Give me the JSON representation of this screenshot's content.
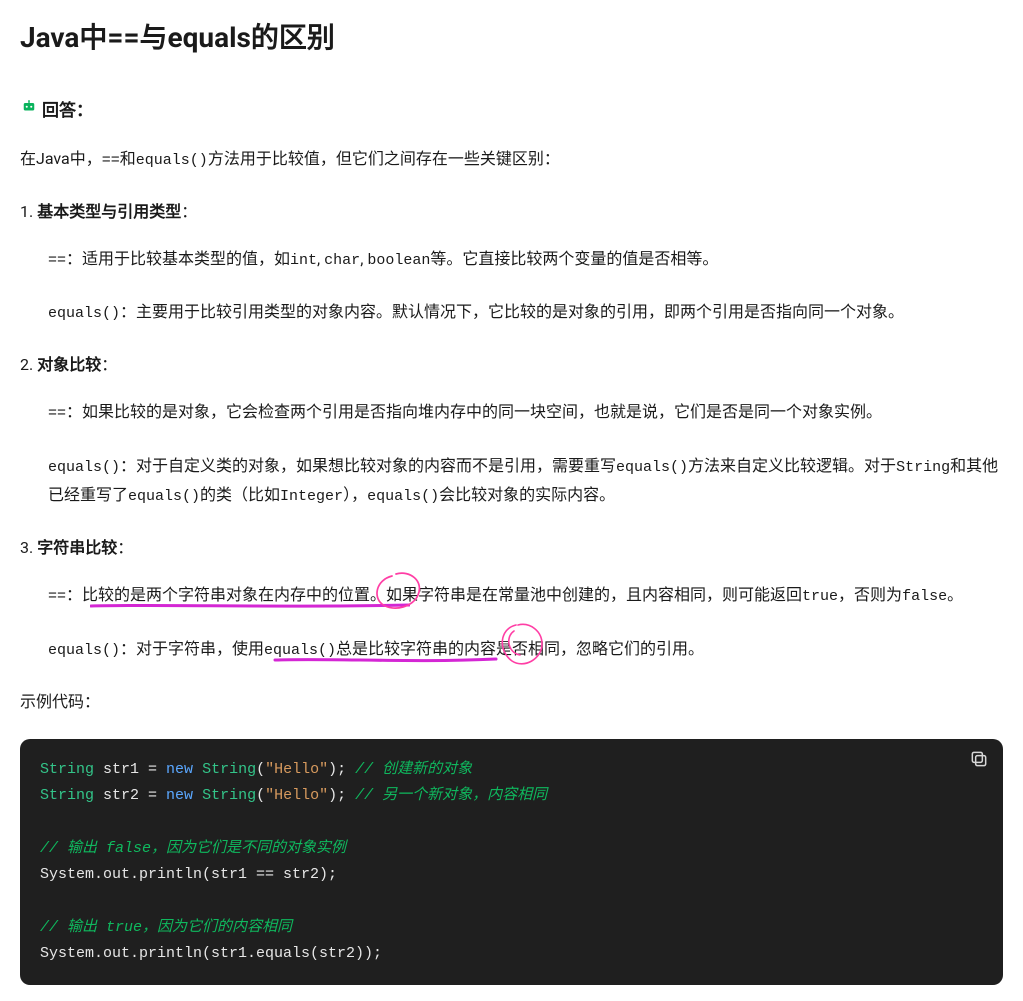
{
  "title": "Java中==与equals的区别",
  "answer_label": "回答：",
  "intro_pre": "在Java中，",
  "intro_code1": "==",
  "intro_mid1": "和",
  "intro_code2": "equals()",
  "intro_post": "方法用于比较值，但它们之间存在一些关键区别：",
  "sections": [
    {
      "num": "1. ",
      "head": "基本类型与引用类型",
      "colon": "：",
      "items": [
        {
          "code": "==",
          "sep": "：适用于比较基本类型的值，如",
          "c2": "int",
          "s2": ", ",
          "c3": "char",
          "s3": ", ",
          "c4": "boolean",
          "s4": "等。它直接比较两个变量的值是否相等。"
        },
        {
          "code": "equals()",
          "sep": "：主要用于比较引用类型的对象内容。默认情况下，它比较的是对象的引用，即两个引用是否指向同一个对象。"
        }
      ]
    },
    {
      "num": "2. ",
      "head": "对象比较",
      "colon": "：",
      "items": [
        {
          "code": "==",
          "sep": "：如果比较的是对象，它会检查两个引用是否指向堆内存中的同一块空间，也就是说，它们是否是同一个对象实例。"
        },
        {
          "code": "equals()",
          "sep": "：对于自定义类的对象，如果想比较对象的内容而不是引用，需要重写",
          "c2": "equals()",
          "s2": "方法来自定义比较逻辑。对于",
          "c3": "String",
          "s3": "和其他已经重写了",
          "c4": "equals()",
          "s4": "的类（比如",
          "c5": "Integer",
          "s5": "），",
          "c6": "equals()",
          "s6": "会比较对象的实际内容。"
        }
      ]
    },
    {
      "num": "3. ",
      "head": "字符串比较",
      "colon": "：",
      "items": [
        {
          "code": "==",
          "sep": "：比较的是两个字符串对象在内存中的位置。如果字符串是在常量池中创建的，且内容相同，则可能返回",
          "c2": "true",
          "s2": "，否则为",
          "c3": "false",
          "s3": "。"
        },
        {
          "code": "equals()",
          "sep": "：对于字符串，使用",
          "c2": "equals()",
          "s2": "总是比较字符串的内容是否相同，忽略它们的引用。"
        }
      ]
    }
  ],
  "example_label": "示例代码：",
  "code": {
    "l1": {
      "t": "String ",
      "v": "str1 ",
      "eq": "= ",
      "kw": "new ",
      "fn": "String",
      "p1": "(",
      "str": "\"Hello\"",
      "p2": "); ",
      "cmt": "// 创建新的对象"
    },
    "l2": {
      "t": "String ",
      "v": "str2 ",
      "eq": "= ",
      "kw": "new ",
      "fn": "String",
      "p1": "(",
      "str": "\"Hello\"",
      "p2": "); ",
      "cmt": "// 另一个新对象，内容相同"
    },
    "l3": {
      "cmt": "// 输出 false，因为它们是不同的对象实例"
    },
    "l4": {
      "txt": "System.out.println(str1 == str2);"
    },
    "l5": {
      "cmt": "// 输出 true，因为它们的内容相同"
    },
    "l6": {
      "txt": "System.out.println(str1.equals(str2));"
    }
  }
}
